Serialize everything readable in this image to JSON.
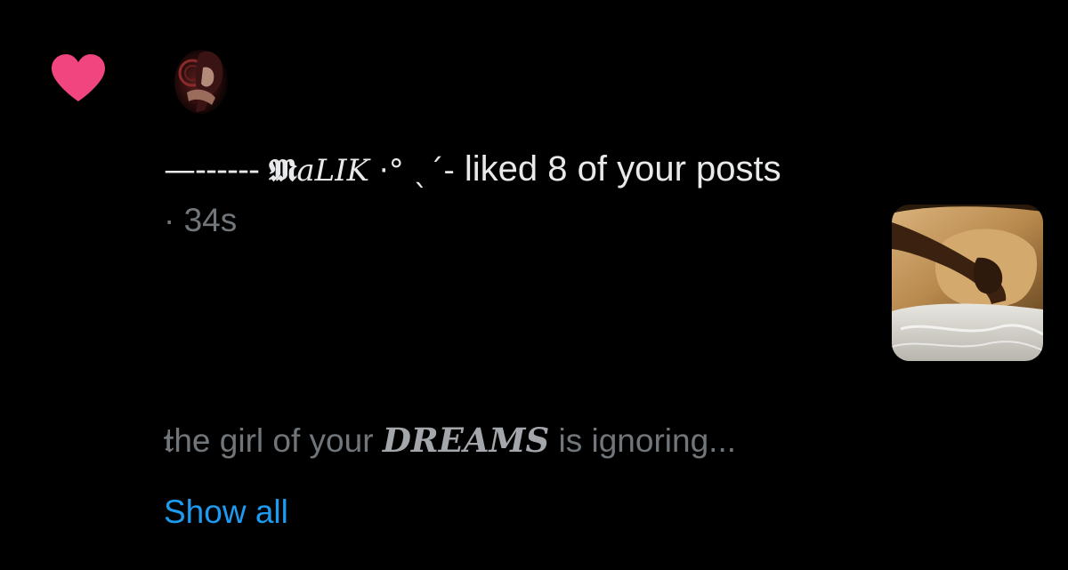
{
  "notification": {
    "type_icon": "heart-icon",
    "avatar_icon": "avatar-image",
    "actor": {
      "name_dash": "—------",
      "name_fraktur": "𝕸",
      "name_italic": "aLIK",
      "name_deco": " ·°  ˎˊ-"
    },
    "action_text": " liked 8 of your posts",
    "timestamp": "· 34s",
    "thumbnail_icon": "post-thumbnail-image",
    "preview": {
      "first_char": "𝔱",
      "part1": "he girl of your ",
      "strong": "DREAMS",
      "part2": " is ignoring..."
    },
    "show_all_label": "Show all"
  },
  "colors": {
    "background": "#000000",
    "primary_text": "#e7e9ea",
    "secondary_text": "#71767b",
    "link": "#1d9bf0",
    "heart": "#f0457e"
  }
}
